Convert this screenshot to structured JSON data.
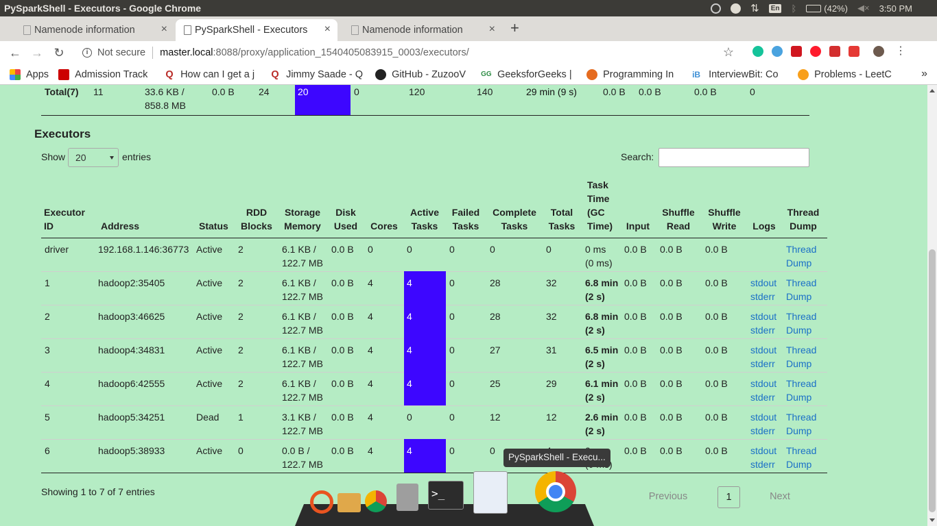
{
  "system_bar": {
    "window_title": "PySparkShell - Executors - Google Chrome",
    "keyboard": "En",
    "battery": "(42%)",
    "clock": "3:50 PM"
  },
  "tabs": [
    {
      "label": "Namenode information",
      "active": false
    },
    {
      "label": "PySparkShell - Executors",
      "active": true
    },
    {
      "label": "Namenode information",
      "active": false
    }
  ],
  "toolbar": {
    "security_label": "Not secure",
    "url_host": "master.local",
    "url_path": ":8088/proxy/application_1540405083915_0003/executors/"
  },
  "bookmarks": [
    {
      "label": "Apps",
      "icon": "apps-grid-icon",
      "color": "#e44"
    },
    {
      "label": "Admission Track",
      "icon": "admission-icon",
      "color": "#c00"
    },
    {
      "label": "How can I get a j",
      "icon": "quora-icon",
      "color": "#b92b27"
    },
    {
      "label": "Jimmy Saade - Q",
      "icon": "quora-icon",
      "color": "#b92b27"
    },
    {
      "label": "GitHub - ZuzooV",
      "icon": "github-icon",
      "color": "#222"
    },
    {
      "label": "GeeksforGeeks |",
      "icon": "gfg-icon",
      "color": "#2f8d46"
    },
    {
      "label": "Programming In",
      "icon": "programming-icon",
      "color": "#e56b1f"
    },
    {
      "label": "InterviewBit: Co",
      "icon": "interviewbit-icon",
      "color": "#3d8fd6"
    },
    {
      "label": "Problems - LeetC",
      "icon": "leetcode-icon",
      "color": "#f89f1b"
    }
  ],
  "summary_total_row": {
    "label": "Total(7)",
    "rdd_blocks": "11",
    "storage_memory_line1": "33.6 KB /",
    "storage_memory_line2": "858.8 MB",
    "disk_used": "0.0 B",
    "cores": "24",
    "active_tasks": "20",
    "failed_tasks": "0",
    "complete_tasks": "120",
    "total_tasks": "140",
    "task_time": "29 min (9 s)",
    "input": "0.0 B",
    "shuffle_read": "0.0 B",
    "shuffle_write": "0.0 B",
    "blacklisted": "0"
  },
  "executors_section": {
    "title": "Executors",
    "show_label": "Show",
    "page_size": "20",
    "entries_label": "entries",
    "search_label": "Search:",
    "search_value": ""
  },
  "table": {
    "headers": {
      "executor_id": [
        "Executor",
        "ID"
      ],
      "address": [
        "Address"
      ],
      "status": [
        "Status"
      ],
      "rdd_blocks": [
        "RDD",
        "Blocks"
      ],
      "storage_memory": [
        "Storage",
        "Memory"
      ],
      "disk_used": [
        "Disk",
        "Used"
      ],
      "cores": [
        "Cores"
      ],
      "active_tasks": [
        "Active",
        "Tasks"
      ],
      "failed_tasks": [
        "Failed",
        "Tasks"
      ],
      "complete_tasks": [
        "Complete",
        "Tasks"
      ],
      "total_tasks": [
        "Total",
        "Tasks"
      ],
      "task_time": [
        "Task",
        "Time",
        "(GC",
        "Time)"
      ],
      "input": [
        "Input"
      ],
      "shuffle_read": [
        "Shuffle",
        "Read"
      ],
      "shuffle_write": [
        "Shuffle",
        "Write"
      ],
      "logs": [
        "Logs"
      ],
      "thread_dump": [
        "Thread",
        "Dump"
      ]
    },
    "rows": [
      {
        "id": "driver",
        "address": "192.168.1.146:36773",
        "status": "Active",
        "rdd": "2",
        "mem1": "6.1 KB /",
        "mem2": "122.7 MB",
        "disk": "0.0 B",
        "cores": "0",
        "active": "0",
        "active_highlight": false,
        "failed": "0",
        "complete": "0",
        "total": "0",
        "time1": "0 ms",
        "time2": "(0 ms)",
        "time_bold": false,
        "input": "0.0 B",
        "sread": "0.0 B",
        "swrite": "0.0 B",
        "stdout": "",
        "stderr": "",
        "td1": "Thread",
        "td2": "Dump"
      },
      {
        "id": "1",
        "address": "hadoop2:35405",
        "status": "Active",
        "rdd": "2",
        "mem1": "6.1 KB /",
        "mem2": "122.7 MB",
        "disk": "0.0 B",
        "cores": "4",
        "active": "4",
        "active_highlight": true,
        "failed": "0",
        "complete": "28",
        "total": "32",
        "time1": "6.8 min",
        "time2": "(2 s)",
        "time_bold": true,
        "input": "0.0 B",
        "sread": "0.0 B",
        "swrite": "0.0 B",
        "stdout": "stdout",
        "stderr": "stderr",
        "td1": "Thread",
        "td2": "Dump"
      },
      {
        "id": "2",
        "address": "hadoop3:46625",
        "status": "Active",
        "rdd": "2",
        "mem1": "6.1 KB /",
        "mem2": "122.7 MB",
        "disk": "0.0 B",
        "cores": "4",
        "active": "4",
        "active_highlight": true,
        "failed": "0",
        "complete": "28",
        "total": "32",
        "time1": "6.8 min",
        "time2": "(2 s)",
        "time_bold": true,
        "input": "0.0 B",
        "sread": "0.0 B",
        "swrite": "0.0 B",
        "stdout": "stdout",
        "stderr": "stderr",
        "td1": "Thread",
        "td2": "Dump"
      },
      {
        "id": "3",
        "address": "hadoop4:34831",
        "status": "Active",
        "rdd": "2",
        "mem1": "6.1 KB /",
        "mem2": "122.7 MB",
        "disk": "0.0 B",
        "cores": "4",
        "active": "4",
        "active_highlight": true,
        "failed": "0",
        "complete": "27",
        "total": "31",
        "time1": "6.5 min",
        "time2": "(2 s)",
        "time_bold": true,
        "input": "0.0 B",
        "sread": "0.0 B",
        "swrite": "0.0 B",
        "stdout": "stdout",
        "stderr": "stderr",
        "td1": "Thread",
        "td2": "Dump"
      },
      {
        "id": "4",
        "address": "hadoop6:42555",
        "status": "Active",
        "rdd": "2",
        "mem1": "6.1 KB /",
        "mem2": "122.7 MB",
        "disk": "0.0 B",
        "cores": "4",
        "active": "4",
        "active_highlight": true,
        "failed": "0",
        "complete": "25",
        "total": "29",
        "time1": "6.1 min",
        "time2": "(2 s)",
        "time_bold": true,
        "input": "0.0 B",
        "sread": "0.0 B",
        "swrite": "0.0 B",
        "stdout": "stdout",
        "stderr": "stderr",
        "td1": "Thread",
        "td2": "Dump"
      },
      {
        "id": "5",
        "address": "hadoop5:34251",
        "status": "Dead",
        "rdd": "1",
        "mem1": "3.1 KB /",
        "mem2": "122.7 MB",
        "disk": "0.0 B",
        "cores": "4",
        "active": "0",
        "active_highlight": false,
        "failed": "0",
        "complete": "12",
        "total": "12",
        "time1": "2.6 min",
        "time2": "(2 s)",
        "time_bold": true,
        "input": "0.0 B",
        "sread": "0.0 B",
        "swrite": "0.0 B",
        "stdout": "stdout",
        "stderr": "stderr",
        "td1": "Thread",
        "td2": "Dump"
      },
      {
        "id": "6",
        "address": "hadoop5:38933",
        "status": "Active",
        "rdd": "0",
        "mem1": "0.0 B /",
        "mem2": "122.7 MB",
        "disk": "0.0 B",
        "cores": "4",
        "active": "4",
        "active_highlight": true,
        "failed": "0",
        "complete": "0",
        "total": "4",
        "time1": "0 ms",
        "time2": "(0 ms)",
        "time_bold": false,
        "input": "0.0 B",
        "sread": "0.0 B",
        "swrite": "0.0 B",
        "stdout": "stdout",
        "stderr": "stderr",
        "td1": "Thread",
        "td2": "Dump"
      }
    ]
  },
  "footer": {
    "info": "Showing 1 to 7 of 7 entries",
    "prev": "Previous",
    "page": "1",
    "next": "Next"
  },
  "dock_tooltip": "PySparkShell - Execu...",
  "colors": {
    "page_bg": "#b5ecc4",
    "active_task_highlight": "#3d06ff",
    "link": "#1a6fc7"
  }
}
